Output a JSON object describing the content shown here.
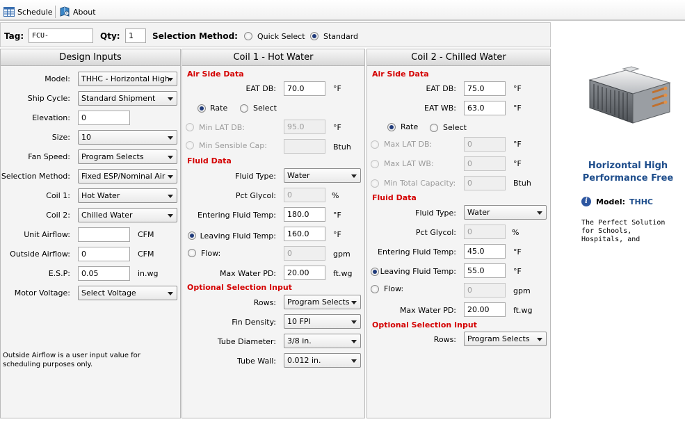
{
  "toolbar": {
    "schedule_label": "Schedule",
    "about_label": "About"
  },
  "header": {
    "tag_label": "Tag:",
    "tag_value": "FCU-",
    "qty_label": "Qty:",
    "qty_value": "1",
    "selection_method_label": "Selection Method:",
    "quick_select_label": "Quick Select",
    "standard_label": "Standard"
  },
  "design": {
    "title": "Design Inputs",
    "model_label": "Model:",
    "model_value": "THHC - Horizontal High",
    "ship_label": "Ship Cycle:",
    "ship_value": "Standard Shipment",
    "elevation_label": "Elevation:",
    "elevation_value": "0",
    "size_label": "Size:",
    "size_value": "10",
    "fan_label": "Fan Speed:",
    "fan_value": "Program Selects",
    "method_label": "Selection Method:",
    "method_value": "Fixed ESP/Nominal Air",
    "coil1_label": "Coil 1:",
    "coil1_value": "Hot Water",
    "coil2_label": "Coil 2:",
    "coil2_value": "Chilled Water",
    "unit_airflow_label": "Unit Airflow:",
    "unit_airflow_value": "",
    "unit_airflow_unit": "CFM",
    "outside_airflow_label": "Outside Airflow:",
    "outside_airflow_value": "0",
    "outside_airflow_unit": "CFM",
    "esp_label": "E.S.P:",
    "esp_value": "0.05",
    "esp_unit": "in.wg",
    "motor_label": "Motor Voltage:",
    "motor_value": "Select Voltage",
    "note": "Outside Airflow is a user input value for scheduling purposes only."
  },
  "coil1": {
    "title": "Coil 1 - Hot Water",
    "air_side": "Air Side Data",
    "eat_db_label": "EAT DB:",
    "eat_db_value": "70.0",
    "eat_db_unit": "°F",
    "rate_label": "Rate",
    "select_label": "Select",
    "min_lat_label": "Min LAT DB:",
    "min_lat_value": "95.0",
    "min_lat_unit": "°F",
    "min_sens_label": "Min Sensible Cap:",
    "min_sens_value": "",
    "min_sens_unit": "Btuh",
    "fluid_data": "Fluid Data",
    "fluid_type_label": "Fluid Type:",
    "fluid_type_value": "Water",
    "pct_glycol_label": "Pct Glycol:",
    "pct_glycol_value": "0",
    "pct_glycol_unit": "%",
    "eft_label": "Entering Fluid Temp:",
    "eft_value": "180.0",
    "eft_unit": "°F",
    "lft_label": "Leaving Fluid Temp:",
    "lft_value": "160.0",
    "lft_unit": "°F",
    "flow_label": "Flow:",
    "flow_value": "0",
    "flow_unit": "gpm",
    "max_pd_label": "Max Water PD:",
    "max_pd_value": "20.00",
    "max_pd_unit": "ft.wg",
    "optional": "Optional Selection Input",
    "rows_label": "Rows:",
    "rows_value": "Program Selects",
    "fin_label": "Fin Density:",
    "fin_value": "10 FPI",
    "tube_dia_label": "Tube Diameter:",
    "tube_dia_value": "3/8 in.",
    "tube_wall_label": "Tube Wall:",
    "tube_wall_value": "0.012 in."
  },
  "coil2": {
    "title": "Coil 2 - Chilled Water",
    "air_side": "Air Side Data",
    "eat_db_label": "EAT DB:",
    "eat_db_value": "75.0",
    "eat_db_unit": "°F",
    "eat_wb_label": "EAT WB:",
    "eat_wb_value": "63.0",
    "eat_wb_unit": "°F",
    "rate_label": "Rate",
    "select_label": "Select",
    "max_lat_db_label": "Max LAT DB:",
    "max_lat_db_value": "0",
    "max_lat_db_unit": "°F",
    "max_lat_wb_label": "Max LAT WB:",
    "max_lat_wb_value": "0",
    "max_lat_wb_unit": "°F",
    "min_total_label": "Min Total Capacity:",
    "min_total_value": "0",
    "min_total_unit": "Btuh",
    "fluid_data": "Fluid Data",
    "fluid_type_label": "Fluid Type:",
    "fluid_type_value": "Water",
    "pct_glycol_label": "Pct Glycol:",
    "pct_glycol_value": "0",
    "pct_glycol_unit": "%",
    "eft_label": "Entering Fluid Temp:",
    "eft_value": "45.0",
    "eft_unit": "°F",
    "lft_label": "Leaving Fluid Temp:",
    "lft_value": "55.0",
    "lft_unit": "°F",
    "flow_label": "Flow:",
    "flow_value": "0",
    "flow_unit": "gpm",
    "max_pd_label": "Max Water PD:",
    "max_pd_value": "20.00",
    "max_pd_unit": "ft.wg",
    "optional": "Optional Selection Input",
    "rows_label": "Rows:",
    "rows_value": "Program Selects"
  },
  "product": {
    "title_line1": "Horizontal High",
    "title_line2": "Performance Free",
    "model_label": "Model:",
    "model_value": "THHC",
    "description": "The Perfect Solution\nfor Schools,\nHospitals, and"
  }
}
